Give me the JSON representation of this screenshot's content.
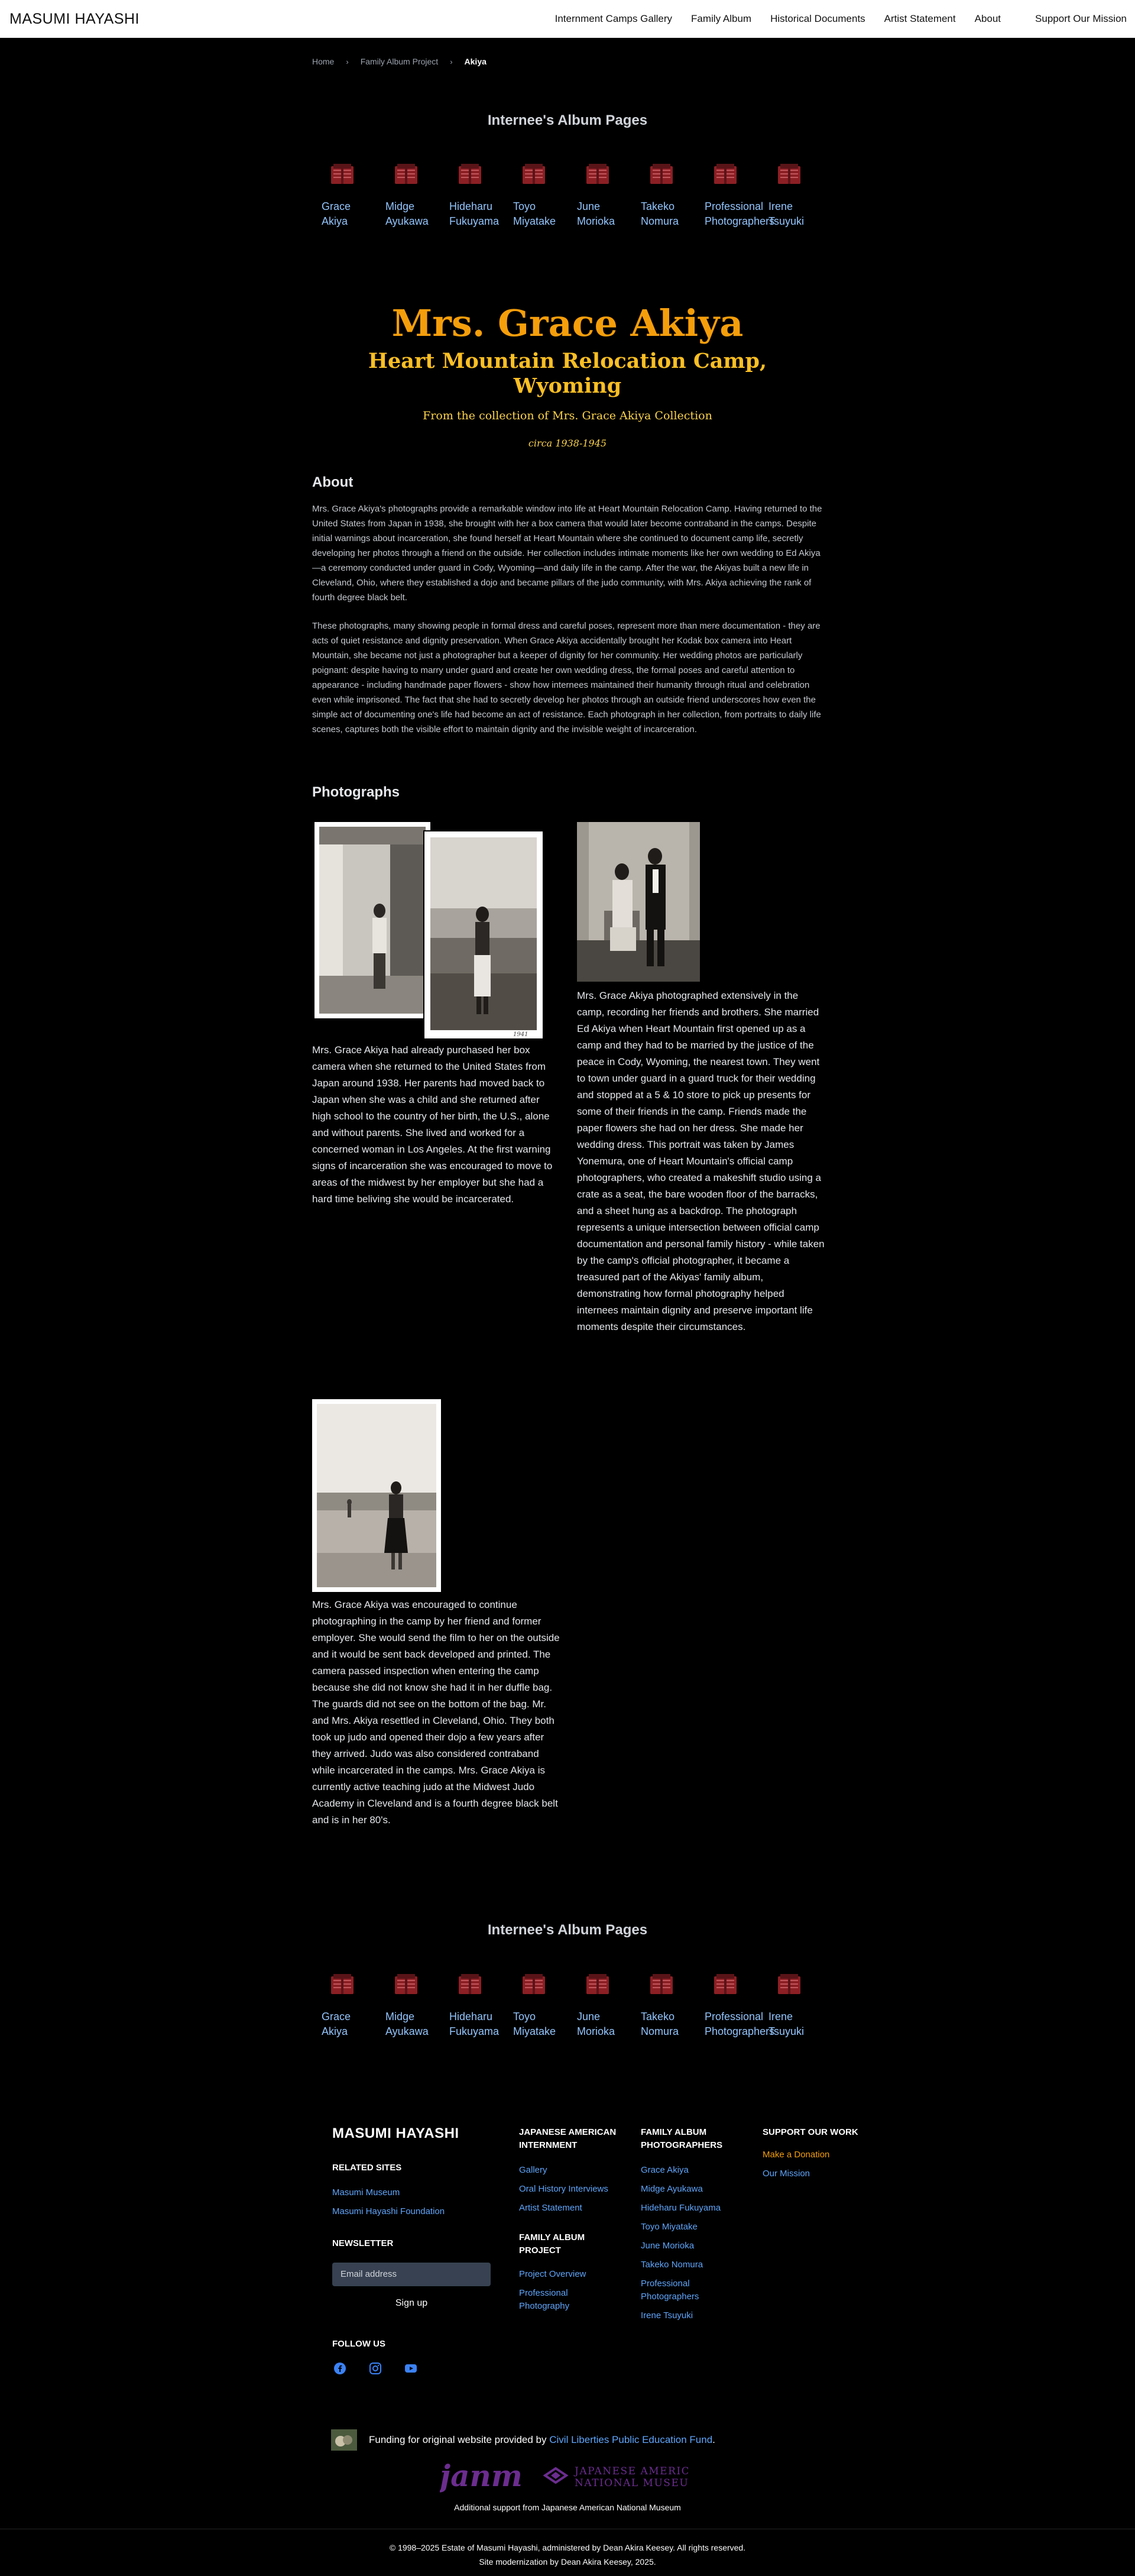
{
  "header": {
    "brand": "MASUMI HAYASHI",
    "nav": [
      "Internment Camps Gallery",
      "Family Album",
      "Historical Documents",
      "Artist Statement",
      "About"
    ],
    "support": "Support Our Mission"
  },
  "breadcrumb": [
    "Home",
    "Family Album Project",
    "Akiya"
  ],
  "album": {
    "title": "Internee's Album Pages",
    "items": [
      {
        "line1": "Grace",
        "line2": "Akiya"
      },
      {
        "line1": "Midge",
        "line2": "Ayukawa"
      },
      {
        "line1": "Hideharu",
        "line2": "Fukuyama"
      },
      {
        "line1": "Toyo",
        "line2": "Miyatake"
      },
      {
        "line1": "June",
        "line2": "Morioka"
      },
      {
        "line1": "Takeko",
        "line2": "Nomura"
      },
      {
        "line1": "Professional",
        "line2": "Photographers"
      },
      {
        "line1": "Irene",
        "line2": "Tsuyuki"
      }
    ],
    "icon_color": "#8b1f24"
  },
  "hero": {
    "name": "Mrs. Grace Akiya",
    "camp": "Heart Mountain Relocation Camp, Wyoming",
    "collection": "From the collection of Mrs. Grace Akiya Collection",
    "date": "circa 1938-1945"
  },
  "about": {
    "heading": "About",
    "p1": "Mrs. Grace Akiya's photographs provide a remarkable window into life at Heart Mountain Relocation Camp. Having returned to the United States from Japan in 1938, she brought with her a box camera that would later become contraband in the camps. Despite initial warnings about incarceration, she found herself at Heart Mountain where she continued to document camp life, secretly developing her photos through a friend on the outside. Her collection includes intimate moments like her own wedding to Ed Akiya—a ceremony conducted under guard in Cody, Wyoming—and daily life in the camp. After the war, the Akiyas built a new life in Cleveland, Ohio, where they established a dojo and became pillars of the judo community, with Mrs. Akiya achieving the rank of fourth degree black belt.",
    "p2": "These photographs, many showing people in formal dress and careful poses, represent more than mere documentation - they are acts of quiet resistance and dignity preservation. When Grace Akiya accidentally brought her Kodak box camera into Heart Mountain, she became not just a photographer but a keeper of dignity for her community. Her wedding photos are particularly poignant: despite having to marry under guard and create her own wedding dress, the formal poses and careful attention to appearance - including handmade paper flowers - show how internees maintained their humanity through ritual and celebration even while imprisoned. The fact that she had to secretly develop her photos through an outside friend underscores how even the simple act of documenting one's life had become an act of resistance. Each photograph in her collection, from portraits to daily life scenes, captures both the visible effort to maintain dignity and the invisible weight of incarceration."
  },
  "photos": {
    "heading": "Photographs",
    "caption1": "Mrs. Grace Akiya had already purchased her box camera when she returned to the United States from Japan around 1938. Her parents had moved back to Japan when she was a child and she returned after high school to the country of her birth, the U.S., alone and without parents. She lived and worked for a concerned woman in Los Angeles. At the first warning signs of incarceration she was encouraged to move to areas of the midwest by her employer but she had a hard time beliving she would be incarcerated.",
    "caption2": "Mrs. Grace Akiya photographed extensively in the camp, recording her friends and brothers. She married Ed Akiya when Heart Mountain first opened up as a camp and they had to be married by the justice of the peace in Cody, Wyoming, the nearest town. They went to town under guard in a guard truck for their wedding and stopped at a 5 & 10 store to pick up presents for some of their friends in the camp. Friends made the paper flowers she had on her dress. She made her wedding dress. This portrait was taken by James Yonemura, one of Heart Mountain's official camp photographers, who created a makeshift studio using a crate as a seat, the bare wooden floor of the barracks, and a sheet hung as a backdrop. The photograph represents a unique intersection between official camp documentation and personal family history - while taken by the camp's official photographer, it became a treasured part of the Akiyas' family album, demonstrating how formal photography helped internees maintain dignity and preserve important life moments despite their circumstances.",
    "caption3": "Mrs. Grace Akiya was encouraged to continue photographing in the camp by her friend and former employer. She would send the film to her on the outside and it would be sent back developed and printed. The camera passed inspection when entering the camp because she did not know she had it in her duffle bag. The guards did not see on the bottom of the bag. Mr. and Mrs. Akiya resettled in Cleveland, Ohio. They both took up judo and opened their dojo a few years after they arrived. Judo was also considered contraband while incarcerated in the camps. Mrs. Grace Akiya is currently active teaching judo at the Midwest Judo Academy in Cleveland and is a fourth degree black belt and is in her 80's."
  },
  "footer": {
    "brand": "MASUMI HAYASHI",
    "related_heading": "RELATED SITES",
    "related": [
      "Masumi Museum",
      "Masumi Hayashi Foundation"
    ],
    "newsletter_heading": "NEWSLETTER",
    "email_placeholder": "Email address",
    "signup": "Sign up",
    "follow_heading": "FOLLOW US",
    "internment_heading_1": "JAPANESE AMERICAN",
    "internment_heading_2": "INTERNMENT",
    "internment_links": [
      "Gallery",
      "Oral History Interviews",
      "Artist Statement"
    ],
    "project_heading_1": "FAMILY ALBUM",
    "project_heading_2": "PROJECT",
    "project_links": [
      "Project Overview",
      "Professional",
      "Photography"
    ],
    "photographers_heading_1": "FAMILY ALBUM",
    "photographers_heading_2": "PHOTOGRAPHERS",
    "photographers": [
      "Grace Akiya",
      "Midge Ayukawa",
      "Hideharu Fukuyama",
      "Toyo Miyatake",
      "June Morioka",
      "Takeko Nomura",
      "Professional",
      "Photographers",
      "Irene Tsuyuki"
    ],
    "support_heading": "SUPPORT OUR WORK",
    "donate": "Make a Donation",
    "mission": "Our Mission",
    "funding_prefix": "Funding for original website provided by ",
    "funding_link": "Civil Liberties Public Education Fund",
    "funding_suffix": ".",
    "janm_logo": "janm",
    "janm_name_1": "JAPANESE AMERICAN",
    "janm_name_2": "NATIONAL MUSEUM",
    "janm_support": "Additional support from Japanese American National Museum",
    "copyright": "© 1998–2025 Estate of Masumi Hayashi, administered by Dean Akira Keesey. All rights reserved.",
    "modernization": "Site modernization by Dean Akira Keesey, 2025.",
    "accent_link": "#60a5fa",
    "donate_color": "#f59e0b",
    "janm_color": "#6b2d8f"
  }
}
